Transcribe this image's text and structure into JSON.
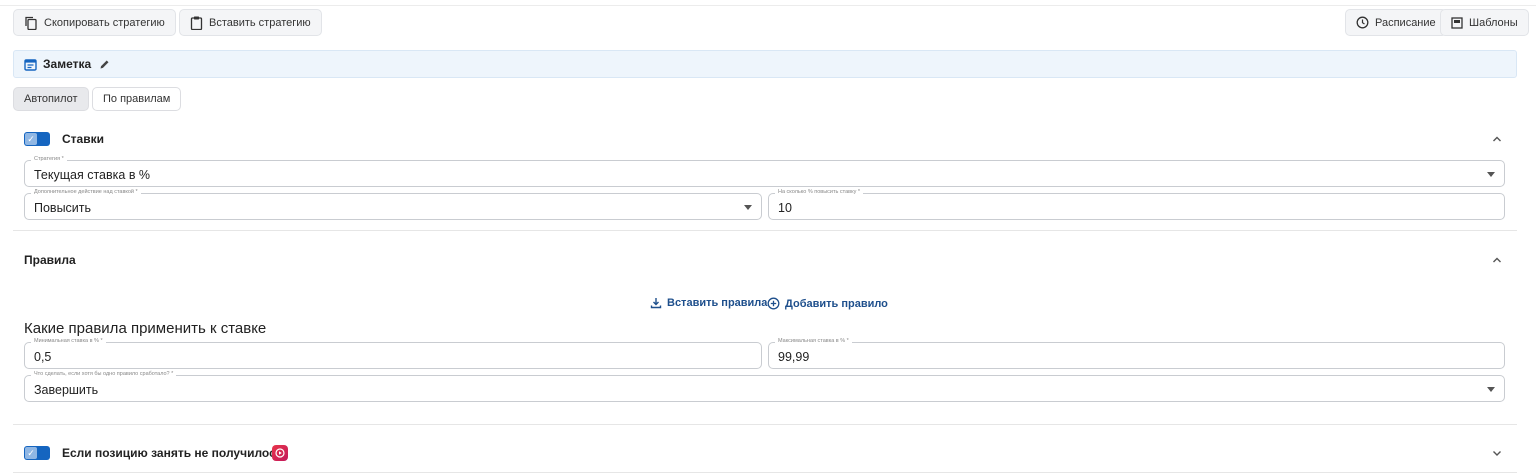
{
  "toolbar": {
    "copy_label": "Скопировать стратегию",
    "paste_label": "Вставить стратегию",
    "schedule_label": "Расписание",
    "templates_label": "Шаблоны"
  },
  "note": {
    "label": "Заметка"
  },
  "tabs": [
    {
      "label": "Автопилот",
      "active": true
    },
    {
      "label": "По правилам",
      "active": false
    }
  ],
  "bids": {
    "title": "Ставки",
    "enabled": true,
    "strategy": {
      "label": "Стратегия *",
      "value": "Текущая ставка в %"
    },
    "action": {
      "label": "Дополнительное действие над ставкой *",
      "value": "Повысить"
    },
    "percent": {
      "label": "На сколько % повысить ставку *",
      "value": "10"
    }
  },
  "rules": {
    "title": "Правила",
    "paste_rules": "Вставить правила",
    "add_rule": "Добавить правило",
    "heading": "Какие правила применить к ставке",
    "min_bid": {
      "label": "Минимальная ставка в % *",
      "value": "0,5"
    },
    "max_bid": {
      "label": "Максимальная ставка в % *",
      "value": "99,99"
    },
    "on_trigger": {
      "label": "Что сделать, если хотя бы одно правило сработало? *",
      "value": "Завершить"
    }
  },
  "fallback": {
    "title": "Если позицию занять не получилось",
    "enabled": true
  },
  "colors": {
    "accent": "#1565c0",
    "link": "#1e4f8c",
    "note_bg": "#eef5fc"
  }
}
